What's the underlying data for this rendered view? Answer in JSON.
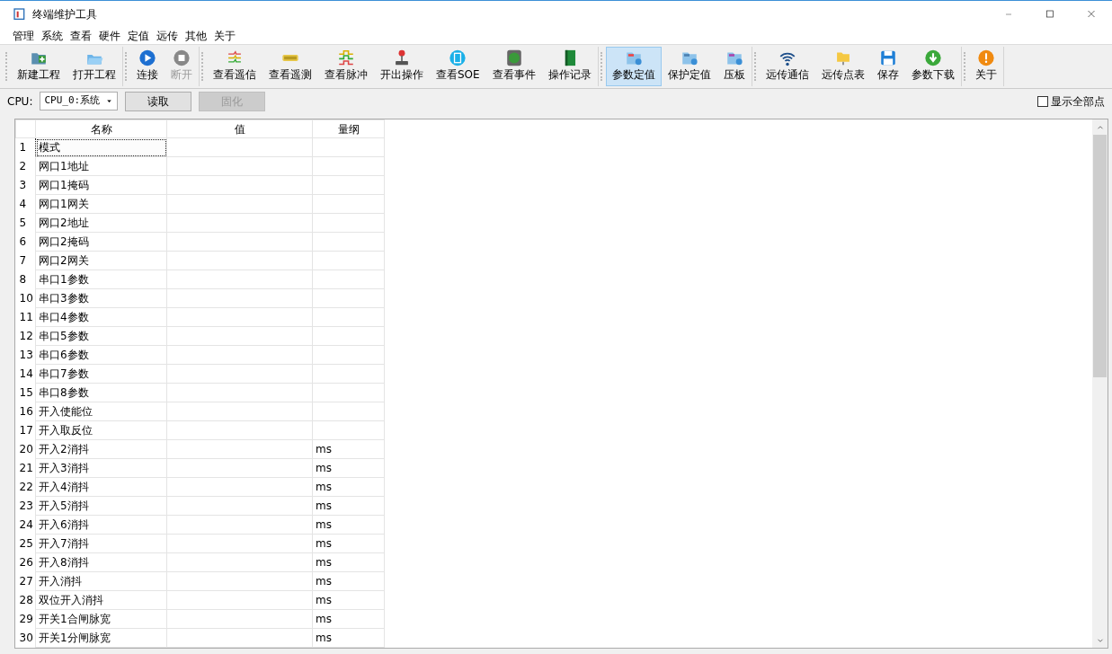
{
  "window": {
    "title": "终端维护工具"
  },
  "menu": [
    "管理",
    "系统",
    "查看",
    "硬件",
    "定值",
    "远传",
    "其他",
    "关于"
  ],
  "toolbar": [
    {
      "group": [
        {
          "label": "新建工程",
          "selected": false,
          "disabled": false
        },
        {
          "label": "打开工程",
          "selected": false,
          "disabled": false
        }
      ]
    },
    {
      "group": [
        {
          "label": "连接",
          "selected": false,
          "disabled": false
        },
        {
          "label": "断开",
          "selected": false,
          "disabled": true
        }
      ]
    },
    {
      "group": [
        {
          "label": "查看遥信",
          "selected": false,
          "disabled": false
        },
        {
          "label": "查看遥测",
          "selected": false,
          "disabled": false
        },
        {
          "label": "查看脉冲",
          "selected": false,
          "disabled": false
        },
        {
          "label": "开出操作",
          "selected": false,
          "disabled": false
        },
        {
          "label": "查看SOE",
          "selected": false,
          "disabled": false
        },
        {
          "label": "查看事件",
          "selected": false,
          "disabled": false
        },
        {
          "label": "操作记录",
          "selected": false,
          "disabled": false
        }
      ]
    },
    {
      "group": [
        {
          "label": "参数定值",
          "selected": true,
          "disabled": false
        },
        {
          "label": "保护定值",
          "selected": false,
          "disabled": false
        },
        {
          "label": "压板",
          "selected": false,
          "disabled": false
        }
      ]
    },
    {
      "group": [
        {
          "label": "远传通信",
          "selected": false,
          "disabled": false
        },
        {
          "label": "远传点表",
          "selected": false,
          "disabled": false
        },
        {
          "label": "保存",
          "selected": false,
          "disabled": false
        },
        {
          "label": "参数下载",
          "selected": false,
          "disabled": false
        }
      ]
    },
    {
      "group": [
        {
          "label": "关于",
          "selected": false,
          "disabled": false
        }
      ]
    }
  ],
  "cpu_bar": {
    "label": "CPU:",
    "select_value": "CPU_0:系统",
    "buttons": [
      {
        "label": "读取",
        "disabled": false
      },
      {
        "label": "固化",
        "disabled": true
      }
    ],
    "show_all": {
      "label": "显示全部点",
      "checked": false
    }
  },
  "table": {
    "columns": [
      "名称",
      "值",
      "量纲"
    ],
    "rows": [
      {
        "num": "1",
        "name": "模式",
        "unit": "",
        "focused": true
      },
      {
        "num": "2",
        "name": "网口1地址",
        "unit": "",
        "focused": false
      },
      {
        "num": "3",
        "name": "网口1掩码",
        "unit": "",
        "focused": false
      },
      {
        "num": "4",
        "name": "网口1网关",
        "unit": "",
        "focused": false
      },
      {
        "num": "5",
        "name": "网口2地址",
        "unit": "",
        "focused": false
      },
      {
        "num": "6",
        "name": "网口2掩码",
        "unit": "",
        "focused": false
      },
      {
        "num": "7",
        "name": "网口2网关",
        "unit": "",
        "focused": false
      },
      {
        "num": "8",
        "name": "串口1参数",
        "unit": "",
        "focused": false
      },
      {
        "num": "10",
        "name": "串口3参数",
        "unit": "",
        "focused": false
      },
      {
        "num": "11",
        "name": "串口4参数",
        "unit": "",
        "focused": false
      },
      {
        "num": "12",
        "name": "串口5参数",
        "unit": "",
        "focused": false
      },
      {
        "num": "13",
        "name": "串口6参数",
        "unit": "",
        "focused": false
      },
      {
        "num": "14",
        "name": "串口7参数",
        "unit": "",
        "focused": false
      },
      {
        "num": "15",
        "name": "串口8参数",
        "unit": "",
        "focused": false
      },
      {
        "num": "16",
        "name": "开入使能位",
        "unit": "",
        "focused": false
      },
      {
        "num": "17",
        "name": "开入取反位",
        "unit": "",
        "focused": false
      },
      {
        "num": "20",
        "name": "开入2消抖",
        "unit": "ms",
        "focused": false
      },
      {
        "num": "21",
        "name": "开入3消抖",
        "unit": "ms",
        "focused": false
      },
      {
        "num": "22",
        "name": "开入4消抖",
        "unit": "ms",
        "focused": false
      },
      {
        "num": "23",
        "name": "开入5消抖",
        "unit": "ms",
        "focused": false
      },
      {
        "num": "24",
        "name": "开入6消抖",
        "unit": "ms",
        "focused": false
      },
      {
        "num": "25",
        "name": "开入7消抖",
        "unit": "ms",
        "focused": false
      },
      {
        "num": "26",
        "name": "开入8消抖",
        "unit": "ms",
        "focused": false
      },
      {
        "num": "27",
        "name": "开入消抖",
        "unit": "ms",
        "focused": false
      },
      {
        "num": "28",
        "name": "双位开入消抖",
        "unit": "ms",
        "focused": false
      },
      {
        "num": "29",
        "name": "开关1合闸脉宽",
        "unit": "ms",
        "focused": false
      },
      {
        "num": "30",
        "name": "开关1分闸脉宽",
        "unit": "ms",
        "focused": false
      }
    ]
  }
}
